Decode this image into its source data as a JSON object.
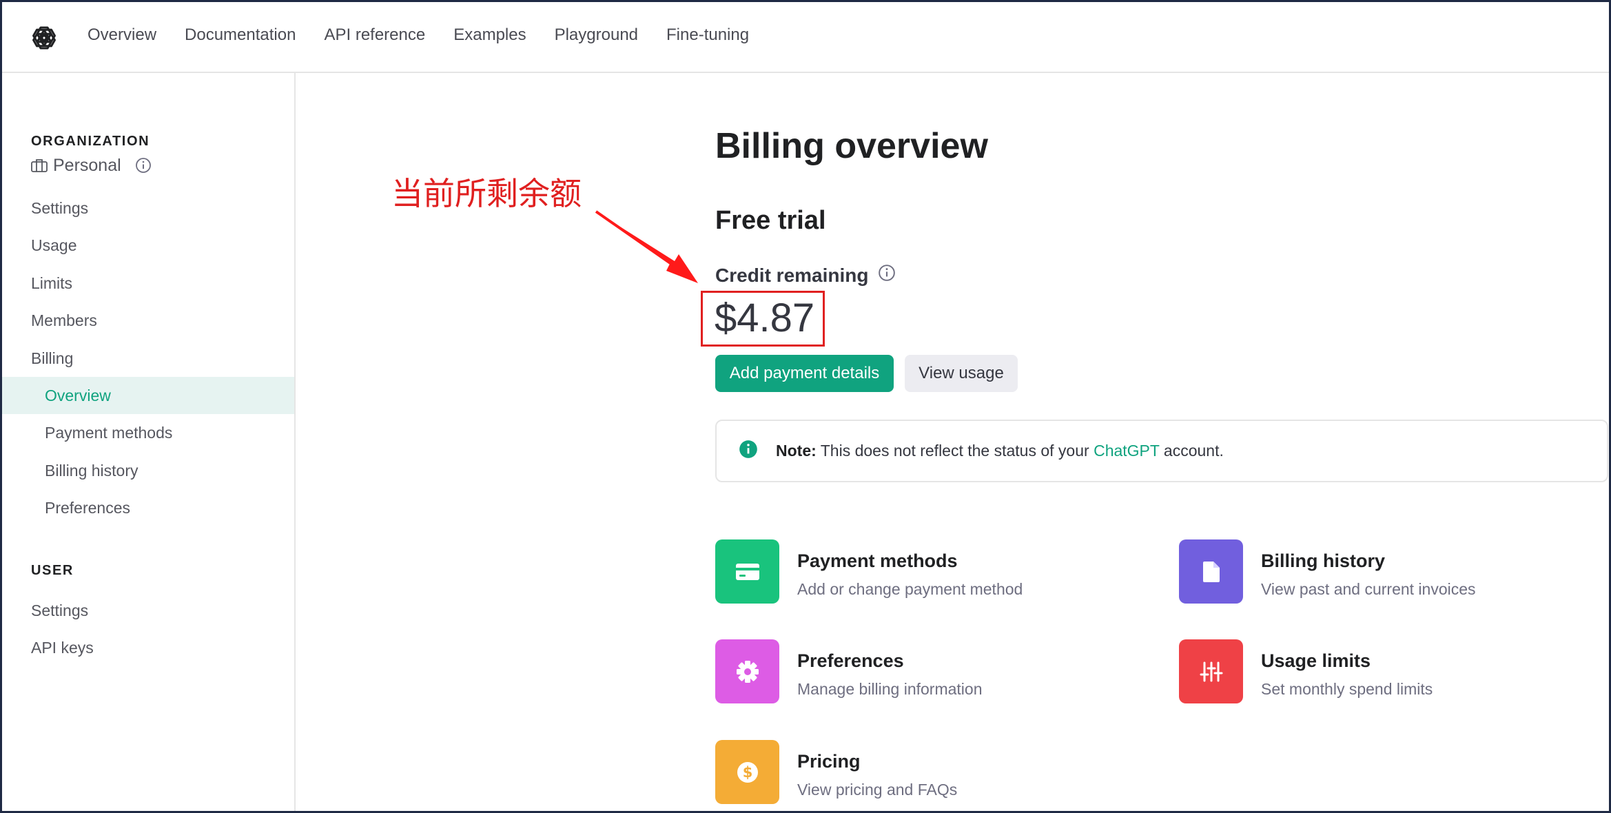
{
  "topnav": {
    "logo_icon": "openai-logo-icon",
    "links": [
      "Overview",
      "Documentation",
      "API reference",
      "Examples",
      "Playground",
      "Fine-tuning"
    ]
  },
  "sidebar": {
    "org_section_title": "ORGANIZATION",
    "org_name": "Personal",
    "org_icons": [
      "briefcase-icon",
      "info-icon"
    ],
    "org_items": [
      {
        "label": "Settings"
      },
      {
        "label": "Usage"
      },
      {
        "label": "Limits"
      },
      {
        "label": "Members"
      },
      {
        "label": "Billing"
      },
      {
        "label": "Overview",
        "active": true
      },
      {
        "label": "Payment methods"
      },
      {
        "label": "Billing history"
      },
      {
        "label": "Preferences"
      }
    ],
    "user_section_title": "USER",
    "user_items": [
      {
        "label": "Settings"
      },
      {
        "label": "API keys"
      }
    ]
  },
  "main": {
    "title": "Billing overview",
    "plan_title": "Free trial",
    "credit_label": "Credit remaining",
    "credit_value": "$4.87",
    "add_payment_button": "Add payment details",
    "view_usage_button": "View usage",
    "note": {
      "bold": "Note:",
      "text_before": " This does not reflect the status of your ",
      "link": "ChatGPT",
      "text_after": " account."
    },
    "cards": [
      {
        "title": "Payment methods",
        "subtitle": "Add or change payment method",
        "icon": "credit-card-icon",
        "color": "#19c37d"
      },
      {
        "title": "Billing history",
        "subtitle": "View past and current invoices",
        "icon": "document-icon",
        "color": "#715fde"
      },
      {
        "title": "Preferences",
        "subtitle": "Manage billing information",
        "icon": "gear-icon",
        "color": "#dd5ce5"
      },
      {
        "title": "Usage limits",
        "subtitle": "Set monthly spend limits",
        "icon": "sliders-icon",
        "color": "#ef4146"
      },
      {
        "title": "Pricing",
        "subtitle": "View pricing and FAQs",
        "icon": "dollar-icon",
        "color": "#f4ac36"
      }
    ]
  },
  "annotation": {
    "text": "当前所剩余额",
    "color": "#e02020"
  },
  "colors": {
    "accent": "#10a37f",
    "active_bg": "#e6f3f1"
  }
}
